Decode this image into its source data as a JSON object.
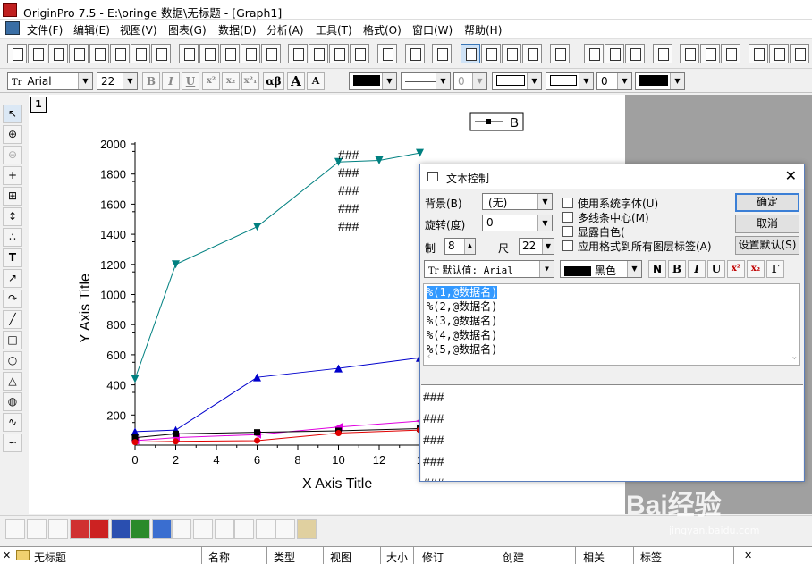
{
  "window": {
    "title": "OriginPro 7.5 - E:\\oringe 数据\\无标题 - [Graph1]"
  },
  "menu": [
    "文件(F)",
    "编辑(E)",
    "视图(V)",
    "图表(G)",
    "数据(D)",
    "分析(A)",
    "工具(T)",
    "格式(O)",
    "窗口(W)",
    "帮助(H)"
  ],
  "format_bar": {
    "font": "Arial",
    "size": "22",
    "bold": "B",
    "italic": "I",
    "underline": "U",
    "superscript": "x²",
    "subscript": "x₂",
    "supsub": "x²₁",
    "greek": "αβ",
    "grow": "A",
    "shrink": "A",
    "line_width": "0",
    "fill_value": "0"
  },
  "graph": {
    "layer_number": "1"
  },
  "chart_data": {
    "type": "line",
    "xlabel": "X Axis Title",
    "ylabel": "Y Axis Title",
    "xlim": [
      0,
      14
    ],
    "ylim": [
      0,
      2000
    ],
    "x_ticks": [
      "0",
      "2",
      "4",
      "6",
      "8",
      "10",
      "12",
      "1"
    ],
    "y_ticks": [
      "200",
      "400",
      "600",
      "800",
      "1000",
      "1200",
      "1400",
      "1600",
      "1800",
      "2000"
    ],
    "legend": {
      "label": "B",
      "position": "top-center"
    },
    "series": [
      {
        "color": "#008080",
        "marker": "triangle-down",
        "x": [
          0,
          2,
          6,
          10,
          12,
          14
        ],
        "y": [
          440,
          1200,
          1450,
          1880,
          1890,
          1940
        ]
      },
      {
        "color": "#0000cc",
        "marker": "triangle-up",
        "x": [
          0,
          2,
          6,
          10,
          14
        ],
        "y": [
          90,
          100,
          450,
          510,
          580
        ]
      },
      {
        "color": "#e000e0",
        "marker": "triangle-left",
        "x": [
          0,
          2,
          6,
          10,
          14
        ],
        "y": [
          30,
          50,
          70,
          120,
          160
        ]
      },
      {
        "color": "#000000",
        "marker": "square",
        "x": [
          0,
          2,
          6,
          10,
          14
        ],
        "y": [
          50,
          75,
          85,
          95,
          110
        ]
      },
      {
        "color": "#e00000",
        "marker": "circle",
        "x": [
          0,
          2,
          6,
          10,
          14
        ],
        "y": [
          20,
          25,
          30,
          80,
          100
        ]
      }
    ],
    "annotation": [
      "###",
      "###",
      "###",
      "###",
      "###"
    ]
  },
  "dialog": {
    "title": "文本控制",
    "background_label": "背景(B)",
    "background_value": "(无)",
    "rotation_label": "旋转(度)",
    "rotation_value": "0",
    "size_label_a": "制",
    "size_value_a": "8",
    "size_label_b": "尺",
    "size_value_b": "22",
    "checkboxes": [
      "使用系统字体(U)",
      "多线条中心(M)",
      "显露白色(",
      "应用格式到所有图层标签(A)"
    ],
    "buttons": {
      "ok": "确定",
      "cancel": "取消",
      "set_default": "设置默认(S)"
    },
    "font_value": "默认值: Arial",
    "color_value": "黑色",
    "style_buttons": [
      "N",
      "B",
      "I",
      "U",
      "x²",
      "x₂",
      "Γ"
    ],
    "text_lines": [
      "%(1,@数据名)",
      "%(2,@数据名)",
      "%(3,@数据名)",
      "%(4,@数据名)",
      "%(5,@数据名)"
    ],
    "preview_lines": [
      "###",
      "###",
      "###",
      "###",
      "###"
    ]
  },
  "statusbar": {
    "folder": "无标题",
    "columns": [
      "名称",
      "类型",
      "视图",
      "大小",
      "修订",
      "创建",
      "相关",
      "标签"
    ]
  },
  "watermark": {
    "brand": "Bai经验",
    "url": "jingyan.baidu.com"
  }
}
